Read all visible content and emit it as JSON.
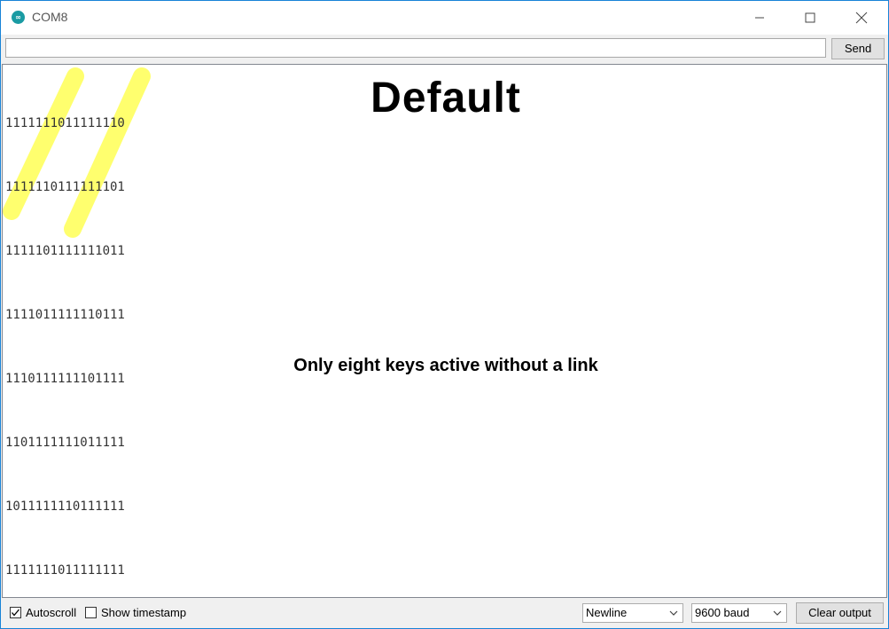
{
  "window": {
    "title": "COM8",
    "app_icon": "arduino-icon",
    "controls": [
      "minimize-icon",
      "maximize-icon",
      "close-icon"
    ]
  },
  "send_bar": {
    "input_value": "",
    "send_label": "Send"
  },
  "output": {
    "lines": [
      "1111111011111110",
      "1111110111111101",
      "1111101111111011",
      "1111011111110111",
      "1110111111101111",
      "1101111111011111",
      "1011111110111111",
      "1111111011111111"
    ],
    "highlight_color": "#ffff55",
    "overlay_title": "Default",
    "overlay_caption": "Only eight keys active without a link"
  },
  "status_bar": {
    "autoscroll_label": "Autoscroll",
    "autoscroll_checked": true,
    "timestamp_label": "Show timestamp",
    "timestamp_checked": false,
    "line_ending": "Newline",
    "baud_rate": "9600 baud",
    "clear_label": "Clear output"
  }
}
